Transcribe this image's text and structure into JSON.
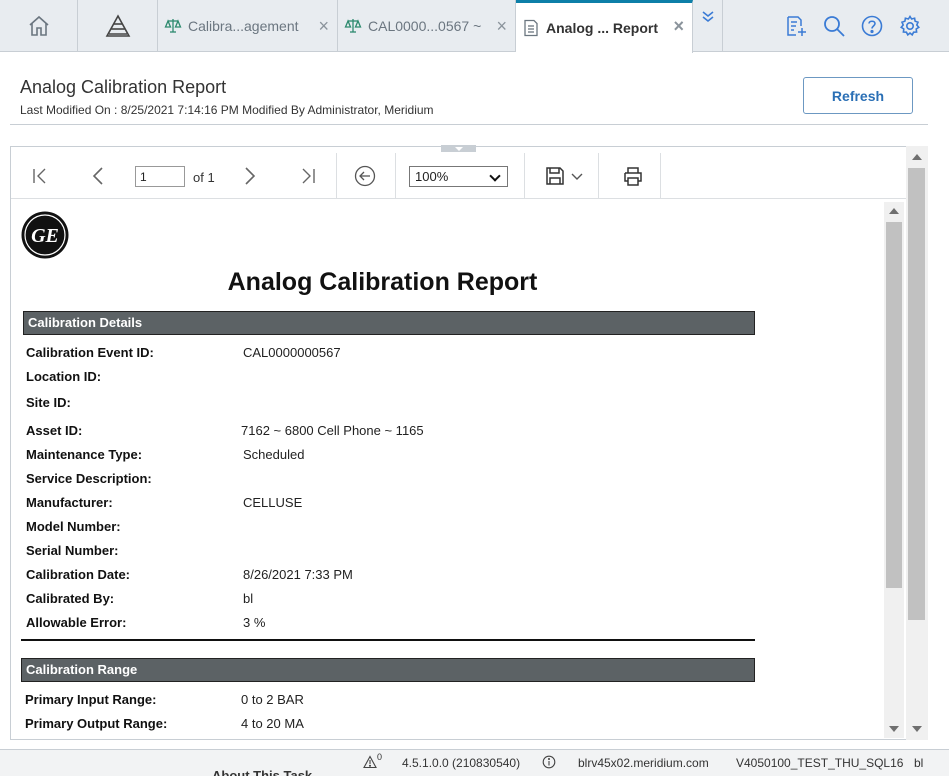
{
  "tabs": [
    {
      "label": "Calibra...agement",
      "icon": "scale-icon"
    },
    {
      "label": "CAL0000...0567 ~",
      "icon": "scale-icon"
    },
    {
      "label": "Analog ... Report",
      "icon": "document-icon",
      "active": true
    }
  ],
  "header": {
    "title": "Analog Calibration Report",
    "modified": "Last Modified On : 8/25/2021 7:14:16 PM Modified By Administrator, Meridium",
    "refresh_label": "Refresh"
  },
  "toolbar": {
    "page_value": "1",
    "page_of": "of 1",
    "zoom": "100%"
  },
  "report": {
    "title": "Analog Calibration Report",
    "logo_text": "GE",
    "details_header": "Calibration Details",
    "details": [
      {
        "label": "Calibration Event ID:",
        "value": "CAL0000000567"
      },
      {
        "label": "Location ID:",
        "value": ""
      },
      {
        "label": "Site ID:",
        "value": ""
      },
      {
        "label": "Asset ID:",
        "value": "7162 ~ 6800 Cell Phone ~ 1165"
      },
      {
        "label": "Maintenance Type:",
        "value": "Scheduled"
      },
      {
        "label": "Service Description:",
        "value": ""
      },
      {
        "label": "Manufacturer:",
        "value": "CELLUSE"
      },
      {
        "label": "Model Number:",
        "value": ""
      },
      {
        "label": "Serial Number:",
        "value": ""
      },
      {
        "label": "Calibration Date:",
        "value": "8/26/2021 7:33 PM"
      },
      {
        "label": "Calibrated By:",
        "value": "bl"
      },
      {
        "label": "Allowable Error:",
        "value": "3 %"
      }
    ],
    "range_header": "Calibration Range",
    "range": [
      {
        "label": "Primary Input Range:",
        "value": "0 to 2 BAR"
      },
      {
        "label": "Primary Output Range:",
        "value": "4 to 20 MA"
      }
    ]
  },
  "statusbar": {
    "alerts": "0",
    "version": "4.5.1.0.0 (210830540)",
    "server": "blrv45x02.meridium.com",
    "database": "V4050100_TEST_THU_SQL16",
    "user": "bl"
  },
  "below_text": "About This Task",
  "colors": {
    "accent": "#0d7fa8",
    "link": "#2a6fb5",
    "section_bar": "#5c6265"
  }
}
